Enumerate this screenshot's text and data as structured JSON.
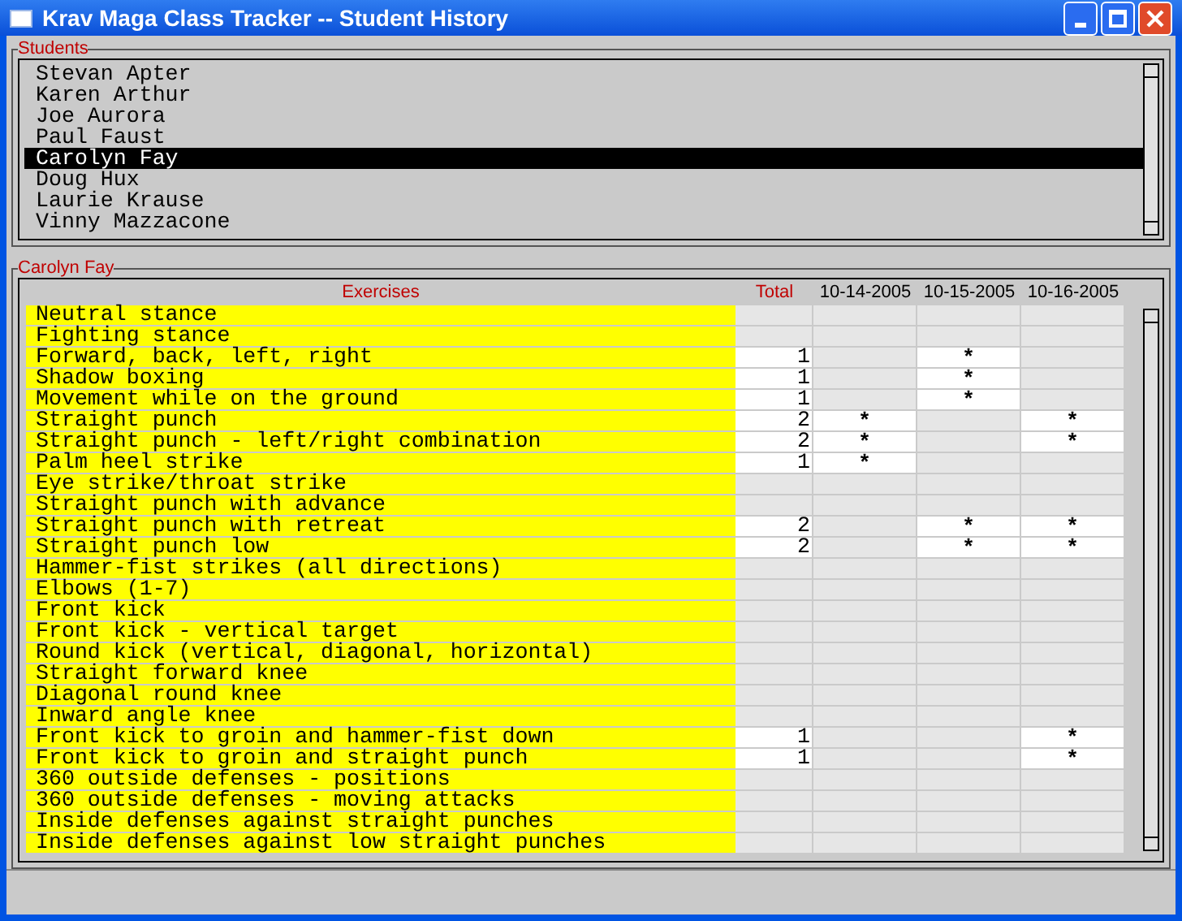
{
  "window": {
    "title": "Krav Maga Class Tracker -- Student History"
  },
  "students": {
    "label": "Students",
    "items": [
      {
        "name": "Stevan Apter",
        "selected": false
      },
      {
        "name": "Karen Arthur",
        "selected": false
      },
      {
        "name": "Joe Aurora",
        "selected": false
      },
      {
        "name": "Paul Faust",
        "selected": false
      },
      {
        "name": "Carolyn Fay",
        "selected": true
      },
      {
        "name": "Doug Hux",
        "selected": false
      },
      {
        "name": "Laurie Krause",
        "selected": false
      },
      {
        "name": "Vinny Mazzacone",
        "selected": false
      }
    ]
  },
  "history": {
    "label": "Carolyn Fay",
    "columns": [
      "Exercises",
      "Total",
      "10-14-2005",
      "10-15-2005",
      "10-16-2005"
    ],
    "rows": [
      {
        "exercise": "Neutral stance",
        "sessions": [
          {
            "attended": false
          },
          {
            "attended": false
          },
          {
            "attended": false
          }
        ]
      },
      {
        "exercise": "Fighting stance",
        "sessions": [
          {
            "attended": false
          },
          {
            "attended": false
          },
          {
            "attended": false
          }
        ]
      },
      {
        "exercise": "Forward, back, left, right",
        "total": "1",
        "sessions": [
          {
            "attended": false
          },
          {
            "attended": true,
            "mark": "*"
          },
          {
            "attended": false
          }
        ]
      },
      {
        "exercise": "Shadow boxing",
        "total": "1",
        "sessions": [
          {
            "attended": false
          },
          {
            "attended": true,
            "mark": "*"
          },
          {
            "attended": false
          }
        ]
      },
      {
        "exercise": "Movement while on the ground",
        "total": "1",
        "sessions": [
          {
            "attended": false
          },
          {
            "attended": true,
            "mark": "*"
          },
          {
            "attended": false
          }
        ]
      },
      {
        "exercise": "Straight punch",
        "total": "2",
        "sessions": [
          {
            "attended": true,
            "mark": "*"
          },
          {
            "attended": false
          },
          {
            "attended": true,
            "mark": "*"
          }
        ]
      },
      {
        "exercise": "Straight punch - left/right combination",
        "total": "2",
        "sessions": [
          {
            "attended": true,
            "mark": "*"
          },
          {
            "attended": false
          },
          {
            "attended": true,
            "mark": "*"
          }
        ]
      },
      {
        "exercise": "Palm heel strike",
        "total": "1",
        "sessions": [
          {
            "attended": true,
            "mark": "*"
          },
          {
            "attended": false
          },
          {
            "attended": false
          }
        ]
      },
      {
        "exercise": "Eye strike/throat strike",
        "sessions": [
          {
            "attended": false
          },
          {
            "attended": false
          },
          {
            "attended": false
          }
        ]
      },
      {
        "exercise": "Straight punch with advance",
        "sessions": [
          {
            "attended": false
          },
          {
            "attended": false
          },
          {
            "attended": false
          }
        ]
      },
      {
        "exercise": "Straight punch with retreat",
        "total": "2",
        "sessions": [
          {
            "attended": false
          },
          {
            "attended": true,
            "mark": "*"
          },
          {
            "attended": true,
            "mark": "*"
          }
        ]
      },
      {
        "exercise": "Straight punch low",
        "total": "2",
        "sessions": [
          {
            "attended": false
          },
          {
            "attended": true,
            "mark": "*"
          },
          {
            "attended": true,
            "mark": "*"
          }
        ]
      },
      {
        "exercise": "Hammer-fist strikes (all directions)",
        "sessions": [
          {
            "attended": false
          },
          {
            "attended": false
          },
          {
            "attended": false
          }
        ]
      },
      {
        "exercise": "Elbows (1-7)",
        "sessions": [
          {
            "attended": false
          },
          {
            "attended": false
          },
          {
            "attended": false
          }
        ]
      },
      {
        "exercise": "Front kick",
        "sessions": [
          {
            "attended": false
          },
          {
            "attended": false
          },
          {
            "attended": false
          }
        ]
      },
      {
        "exercise": "Front kick - vertical target",
        "sessions": [
          {
            "attended": false
          },
          {
            "attended": false
          },
          {
            "attended": false
          }
        ]
      },
      {
        "exercise": "Round kick (vertical, diagonal, horizontal)",
        "sessions": [
          {
            "attended": false
          },
          {
            "attended": false
          },
          {
            "attended": false
          }
        ]
      },
      {
        "exercise": "Straight forward knee",
        "sessions": [
          {
            "attended": false
          },
          {
            "attended": false
          },
          {
            "attended": false
          }
        ]
      },
      {
        "exercise": "Diagonal round knee",
        "sessions": [
          {
            "attended": false
          },
          {
            "attended": false
          },
          {
            "attended": false
          }
        ]
      },
      {
        "exercise": "Inward angle knee",
        "sessions": [
          {
            "attended": false
          },
          {
            "attended": false
          },
          {
            "attended": false
          }
        ]
      },
      {
        "exercise": "Front kick to groin and hammer-fist down",
        "total": "1",
        "sessions": [
          {
            "attended": false
          },
          {
            "attended": false
          },
          {
            "attended": true,
            "mark": "*"
          }
        ]
      },
      {
        "exercise": "Front kick to groin and straight punch",
        "total": "1",
        "sessions": [
          {
            "attended": false
          },
          {
            "attended": false
          },
          {
            "attended": true,
            "mark": "*"
          }
        ]
      },
      {
        "exercise": "360 outside defenses - positions",
        "sessions": [
          {
            "attended": false
          },
          {
            "attended": false
          },
          {
            "attended": false
          }
        ]
      },
      {
        "exercise": "360 outside defenses - moving attacks",
        "sessions": [
          {
            "attended": false
          },
          {
            "attended": false
          },
          {
            "attended": false
          }
        ]
      },
      {
        "exercise": "Inside defenses against straight punches",
        "sessions": [
          {
            "attended": false
          },
          {
            "attended": false
          },
          {
            "attended": false
          }
        ]
      },
      {
        "exercise": "Inside defenses against low straight punches",
        "sessions": [
          {
            "attended": false
          },
          {
            "attended": false
          },
          {
            "attended": false
          }
        ]
      }
    ]
  }
}
